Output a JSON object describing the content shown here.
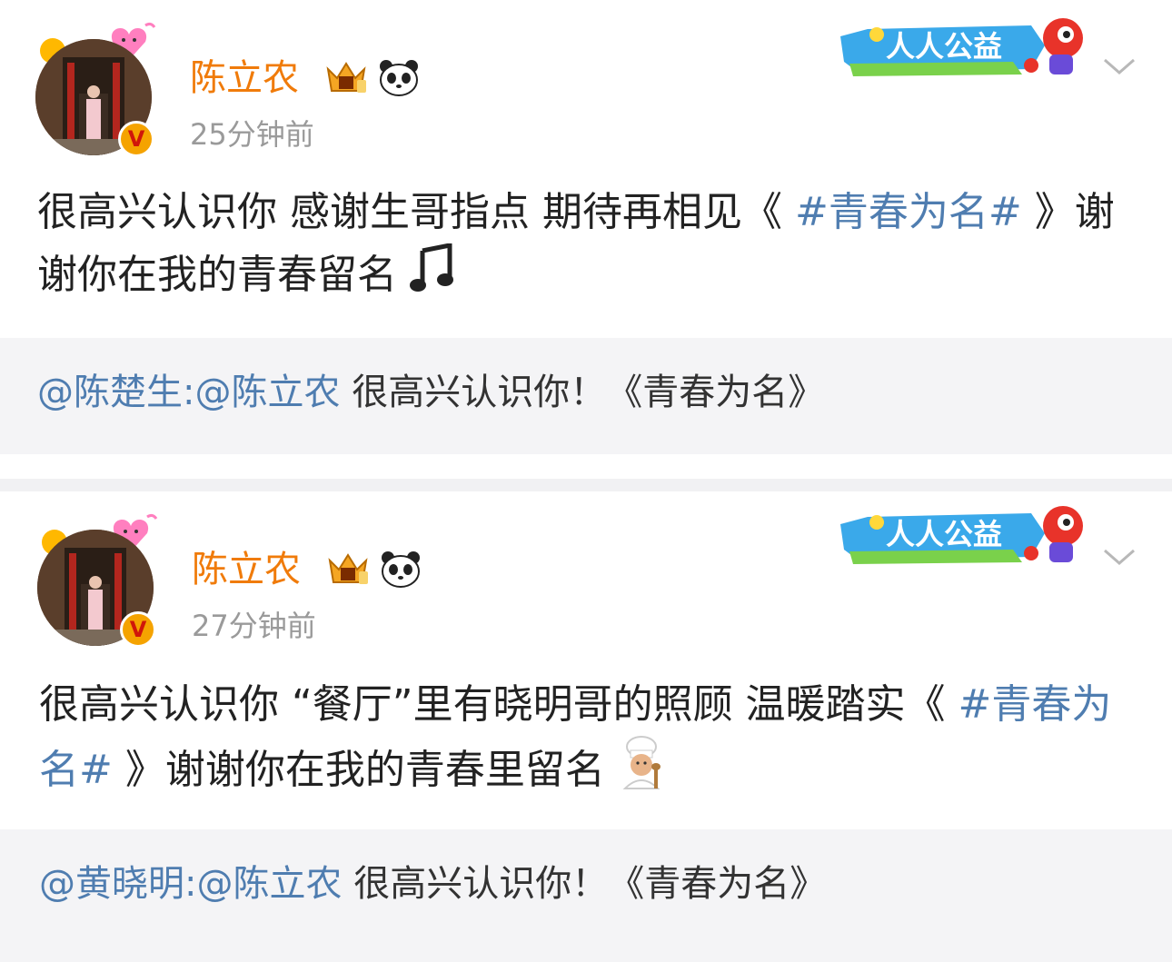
{
  "posts": [
    {
      "username": "陈立农",
      "time": "25分钟前",
      "charity_label": "人人公益",
      "content_a": "很高兴认识你 感谢生哥指点 期待再相见《 ",
      "topic": "#青春为名#",
      "content_b": " 》谢谢你在我的青春留名 ",
      "emoji": "music-note",
      "repost": {
        "author": "@陈楚生",
        "sep": ":",
        "mention": "@陈立农",
        "text": " 很高兴认识你！《青春为名》"
      }
    },
    {
      "username": "陈立农",
      "time": "27分钟前",
      "charity_label": "人人公益",
      "content_a": "很高兴认识你 “餐厅”里有晓明哥的照顾 温暖踏实《 ",
      "topic": "#青春为名#",
      "content_b": " 》谢谢你在我的青春里留名 ",
      "emoji": "cook",
      "repost": {
        "author": "@黄晓明",
        "sep": ":",
        "mention": "@陈立农",
        "text": " 很高兴认识你！《青春为名》"
      }
    }
  ],
  "colors": {
    "username": "#f07b0a",
    "link": "#4f7db0",
    "timestamp": "#9a9a9a",
    "quote_bg": "#f4f4f6"
  }
}
